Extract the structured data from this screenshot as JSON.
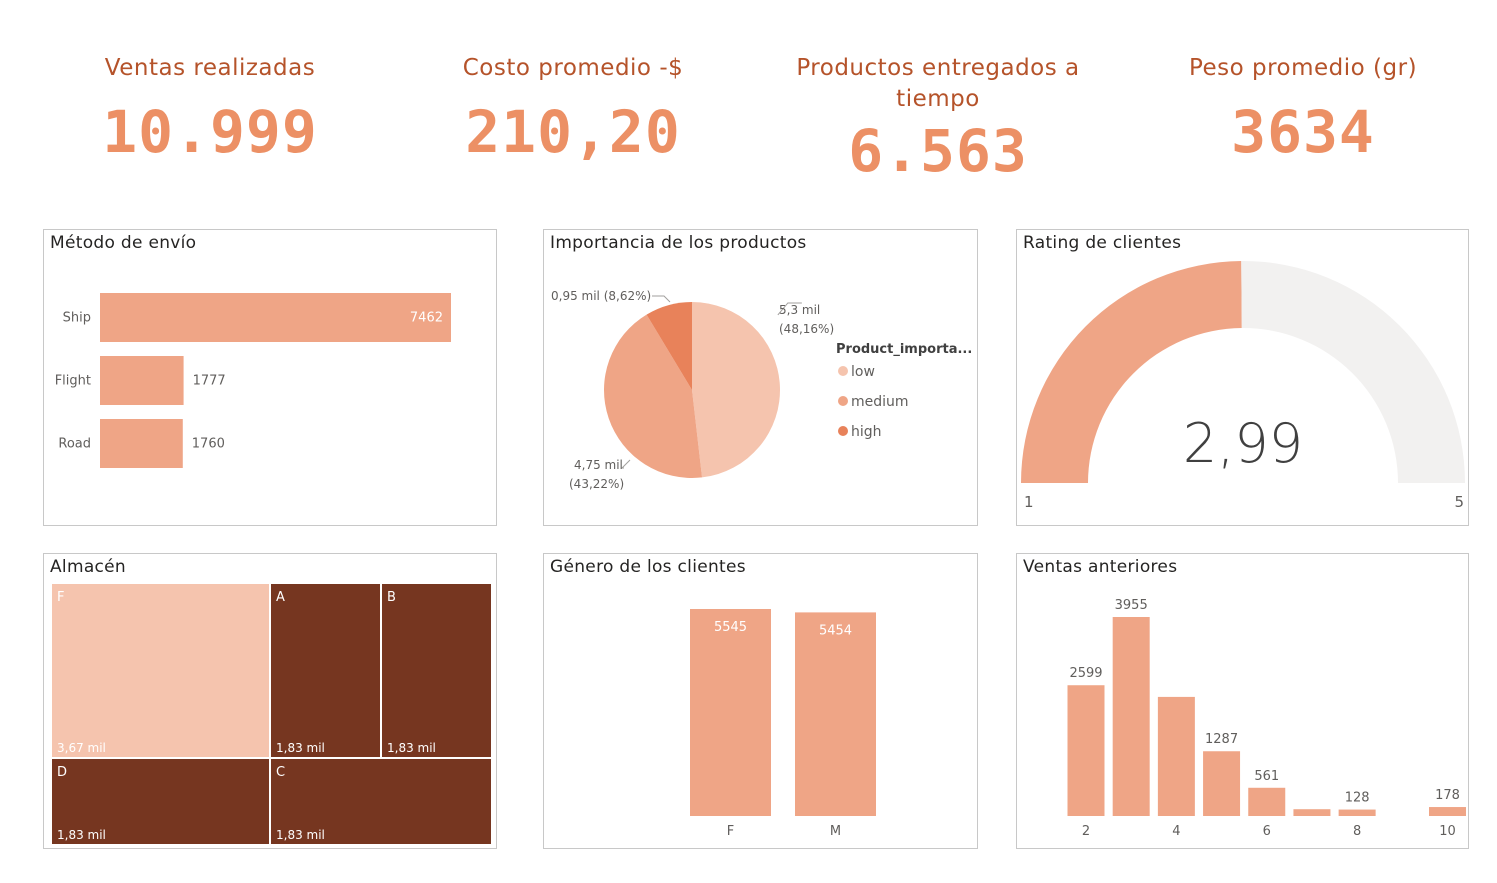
{
  "kpis": [
    {
      "title": "Ventas realizadas",
      "value": "10.999"
    },
    {
      "title": "Costo promedio -$",
      "value": "210,20"
    },
    {
      "title": "Productos entregados a tiempo",
      "value": "6.563"
    },
    {
      "title": "Peso promedio (gr)",
      "value": "3634"
    }
  ],
  "colors": {
    "kpi_title": "#b5532a",
    "kpi_value": "#ec9065",
    "bar": "#efa586",
    "pie_low": "#f5c4ae",
    "pie_medium": "#efa586",
    "pie_high": "#e8825a",
    "tree_light": "#f5c4ae",
    "tree_dark": "#763620",
    "gauge_bg": "#f2f1f0"
  },
  "chart_data": [
    {
      "id": "metodo",
      "type": "bar",
      "orientation": "horizontal",
      "title": "Método de envío",
      "categories": [
        "Ship",
        "Flight",
        "Road"
      ],
      "values": [
        7462,
        1777,
        1760
      ],
      "labels": [
        "7462",
        "1777",
        "1760"
      ]
    },
    {
      "id": "importancia",
      "type": "pie",
      "title": "Importancia de los productos",
      "legend_title": "Product_importa...",
      "legend_position": "right",
      "slices": [
        {
          "name": "low",
          "value": 5.3,
          "pct": 48.16,
          "label_line1": "5,3 mil",
          "label_line2": "(48,16%)"
        },
        {
          "name": "medium",
          "value": 4.75,
          "pct": 43.22,
          "label_line1": "4,75 mil",
          "label_line2": "(43,22%)"
        },
        {
          "name": "high",
          "value": 0.95,
          "pct": 8.62,
          "label_line1": "0,95 mil (8,62%)",
          "label_line2": ""
        }
      ]
    },
    {
      "id": "rating",
      "type": "gauge",
      "title": "Rating de clientes",
      "value": 2.99,
      "value_label": "2,99",
      "min": 1,
      "max": 5,
      "min_label": "1",
      "max_label": "5"
    },
    {
      "id": "almacen",
      "type": "treemap",
      "title": "Almacén",
      "items": [
        {
          "name": "F",
          "value": 3.67,
          "label": "3,67 mil"
        },
        {
          "name": "A",
          "value": 1.83,
          "label": "1,83 mil"
        },
        {
          "name": "B",
          "value": 1.83,
          "label": "1,83 mil"
        },
        {
          "name": "D",
          "value": 1.83,
          "label": "1,83 mil"
        },
        {
          "name": "C",
          "value": 1.83,
          "label": "1,83 mil"
        }
      ]
    },
    {
      "id": "genero",
      "type": "bar",
      "title": "Género de los clientes",
      "categories": [
        "F",
        "M"
      ],
      "values": [
        5545,
        5454
      ],
      "labels": [
        "5545",
        "5454"
      ],
      "ylim": [
        0,
        5545
      ]
    },
    {
      "id": "ventas",
      "type": "bar",
      "title": "Ventas anteriores",
      "x": [
        2,
        3,
        4,
        5,
        6,
        7,
        8,
        10
      ],
      "values": [
        2599,
        3955,
        2367,
        1287,
        561,
        135,
        128,
        178
      ],
      "labels": [
        "2599",
        "3955",
        "",
        "1287",
        "561",
        "",
        "128",
        "178"
      ],
      "xticks": [
        "2",
        "4",
        "6",
        "8",
        "10"
      ],
      "ylim": [
        0,
        3955
      ]
    }
  ]
}
